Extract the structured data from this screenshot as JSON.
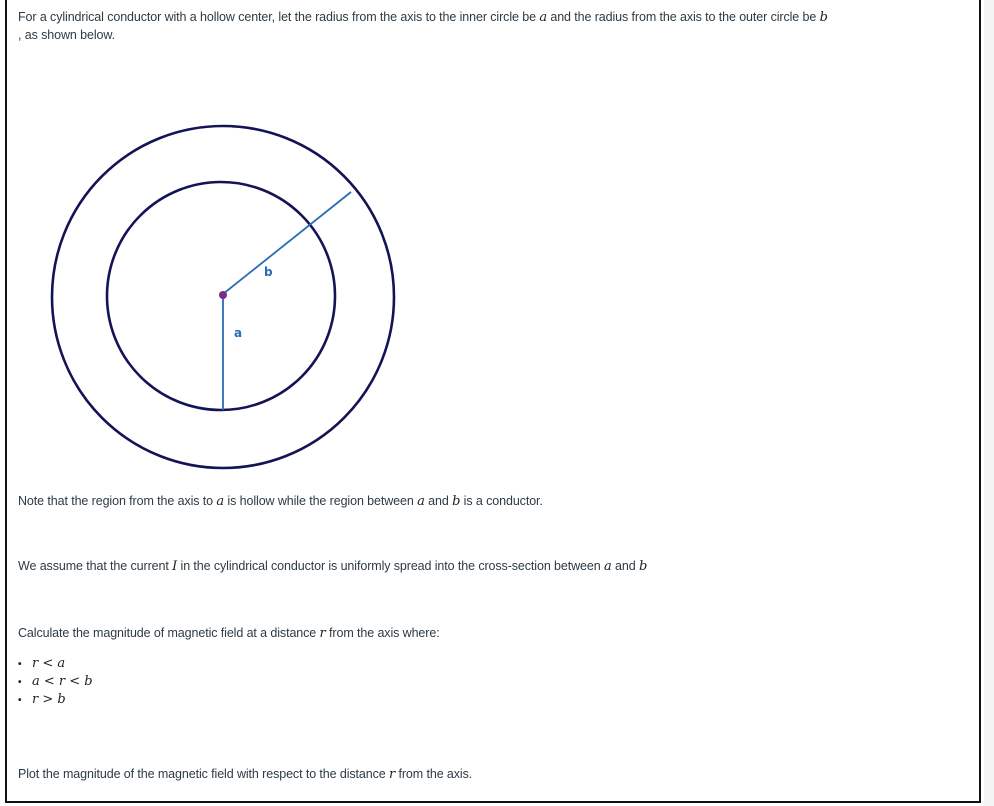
{
  "question": {
    "intro": {
      "part1": "For a cylindrical conductor with a hollow center, let the radius from the axis to the inner circle be ",
      "var_a": "a",
      "part2": " and the radius from the axis to the outer circle be ",
      "var_b": "b",
      "line2": ", as shown below."
    },
    "diagram": {
      "label_inner": "a",
      "label_outer": "b",
      "colors": {
        "circle_stroke": "#131355",
        "radius_line": "#2a6db5",
        "label": "#2a6db5",
        "center_dot": "#7b2a8c"
      }
    },
    "note": {
      "part1": "Note that the region from the axis to ",
      "var_a": "a",
      "part2": " is hollow while the region between ",
      "var_a2": "a",
      "part3": " and ",
      "var_b": "b",
      "part4": " is a conductor."
    },
    "assume": {
      "part1": "We assume that the current ",
      "var_I": "I",
      "part2": " in the cylindrical conductor is uniformly spread into the cross-section between ",
      "var_a": "a",
      "part3": " and ",
      "var_b": "b"
    },
    "calc": {
      "part1": "Calculate the magnitude of magnetic field at a distance ",
      "var_r": "r",
      "part2": " from the axis where:"
    },
    "conditions": [
      {
        "bullet": "•",
        "expr": "r < a"
      },
      {
        "bullet": "•",
        "expr": "a < r < b"
      },
      {
        "bullet": "•",
        "expr": "r > b"
      }
    ],
    "plot": {
      "part1": "Plot the magnitude of the magnetic field with respect to the distance ",
      "var_r": "r",
      "part2": " from the axis."
    }
  }
}
